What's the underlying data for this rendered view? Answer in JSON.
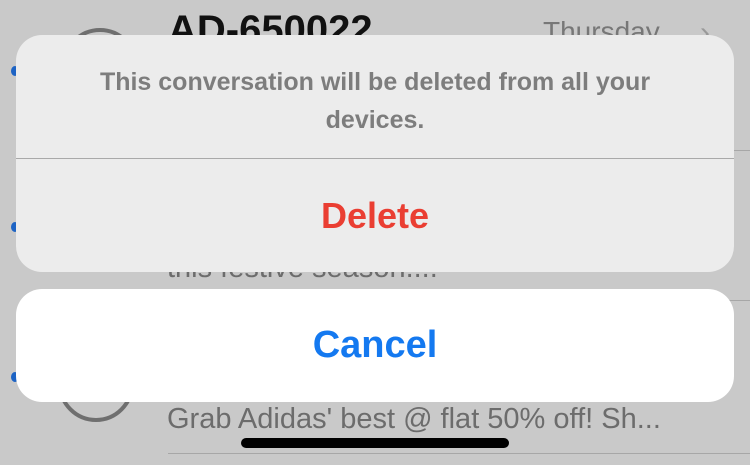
{
  "background_list": {
    "top_row": {
      "sender": "AD-650022",
      "time": "Thursday",
      "chevron": "chevron-right-icon"
    },
    "middle_row": {
      "snippet": "this festive season...."
    },
    "bottom_row": {
      "snippet": "Grab Adidas' best @ flat 50% off! Sh..."
    }
  },
  "action_sheet": {
    "message": "This conversation will be deleted from all your devices.",
    "delete_label": "Delete",
    "cancel_label": "Cancel"
  },
  "colors": {
    "destructive": "#ea3e32",
    "accent": "#1479f0",
    "unread_dot": "#1d63c4"
  }
}
